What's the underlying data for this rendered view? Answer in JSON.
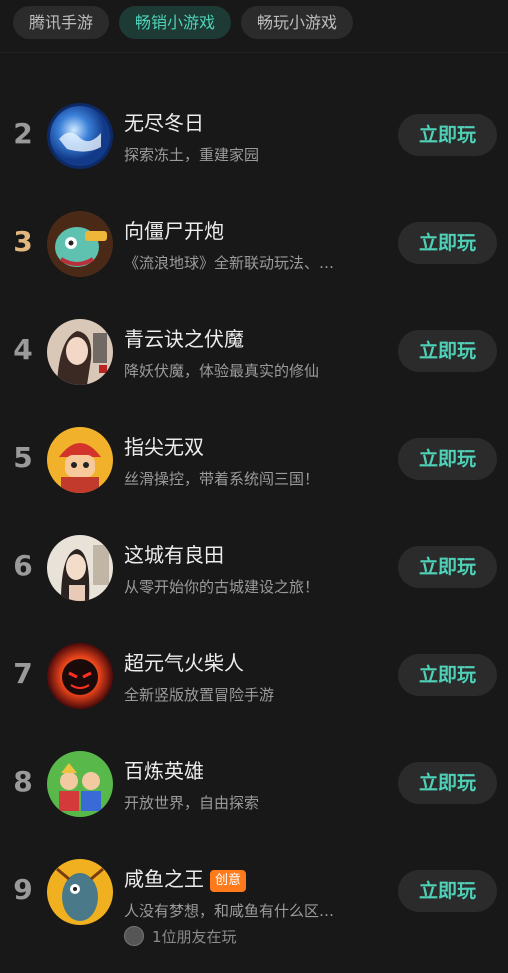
{
  "tabs": [
    {
      "label": "腾讯手游",
      "active": false
    },
    {
      "label": "畅销小游戏",
      "active": true
    },
    {
      "label": "畅玩小游戏",
      "active": false
    }
  ],
  "games": [
    {
      "rank": "2",
      "title": "无尽冬日",
      "desc": "探索冻土，重建家园",
      "play": "立即玩",
      "icon": "snow-globe-icon"
    },
    {
      "rank": "3",
      "title": "向僵尸开炮",
      "desc": "《流浪地球》全新联动玩法、…",
      "play": "立即玩",
      "icon": "zombie-cannon-icon"
    },
    {
      "rank": "4",
      "title": "青云诀之伏魔",
      "desc": "降妖伏魔，体验最真实的修仙",
      "play": "立即玩",
      "icon": "immortal-hero-icon"
    },
    {
      "rank": "5",
      "title": "指尖无双",
      "desc": "丝滑操控，带着系统闯三国！",
      "play": "立即玩",
      "icon": "warrior-icon"
    },
    {
      "rank": "6",
      "title": "这城有良田",
      "desc": "从零开始你的古城建设之旅！",
      "play": "立即玩",
      "icon": "ancient-lady-icon"
    },
    {
      "rank": "7",
      "title": "超元气火柴人",
      "desc": "全新竖版放置冒险手游",
      "play": "立即玩",
      "icon": "fire-stickman-icon"
    },
    {
      "rank": "8",
      "title": "百炼英雄",
      "desc": "开放世界，自由探索",
      "play": "立即玩",
      "icon": "heroes-icon"
    },
    {
      "rank": "9",
      "title": "咸鱼之王",
      "badge": "创意",
      "desc": "人没有梦想，和咸鱼有什么区…",
      "play": "立即玩",
      "icon": "salted-fish-icon",
      "friend": "1位朋友在玩"
    }
  ],
  "colors": {
    "accent": "#4fd1b8",
    "bronze_rank": "#e3b67e",
    "badge": "#ff7a1a"
  }
}
